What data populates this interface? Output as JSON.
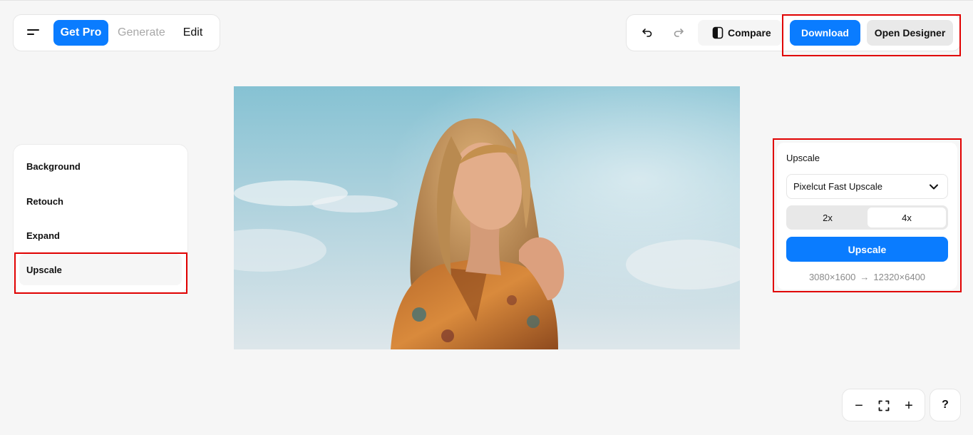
{
  "header": {
    "get_pro": "Get Pro",
    "nav": {
      "generate": "Generate",
      "edit": "Edit"
    }
  },
  "toolbar": {
    "compare": "Compare",
    "download": "Download",
    "open_designer": "Open Designer"
  },
  "sidebar": {
    "items": [
      {
        "label": "Background",
        "active": false
      },
      {
        "label": "Retouch",
        "active": false
      },
      {
        "label": "Expand",
        "active": false
      },
      {
        "label": "Upscale",
        "active": true
      }
    ]
  },
  "upscale_panel": {
    "title": "Upscale",
    "model": "Pixelcut Fast Upscale",
    "scale_options": [
      "2x",
      "4x"
    ],
    "selected_scale": "4x",
    "action": "Upscale",
    "from_size": "3080×1600",
    "to_size": "12320×6400"
  },
  "zoom_controls": {
    "zoom_out": "−",
    "zoom_in": "+"
  },
  "help": {
    "label": "?"
  },
  "colors": {
    "accent": "#0a7cff",
    "highlight": "#e00000",
    "background": "#f6f6f6"
  },
  "icons": [
    "menu-icon",
    "undo-icon",
    "redo-icon",
    "compare-icon",
    "chevron-down-icon",
    "fit-screen-icon"
  ]
}
